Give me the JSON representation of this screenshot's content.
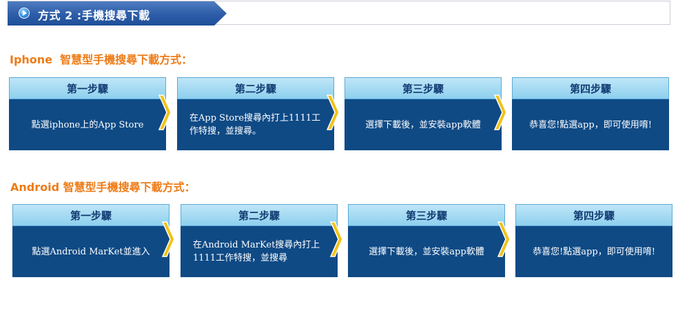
{
  "banner": {
    "title": "方式 2 :手機搜尋下載"
  },
  "iphone_section": {
    "title": "Iphone  智慧型手機搜尋下載方式：",
    "steps": [
      {
        "label": "第一步驟",
        "text": "點選iphone上的App Store"
      },
      {
        "label": "第二步驟",
        "text": "在App Store搜尋內打上1111工作特搜，並搜尋。"
      },
      {
        "label": "第三步驟",
        "text": "選擇下載後，並安裝app軟體"
      },
      {
        "label": "第四步驟",
        "text": "恭喜您!點選app，即可使用唷!"
      }
    ]
  },
  "android_section": {
    "title": "Android 智慧型手機搜尋下載方式：",
    "steps": [
      {
        "label": "第一步驟",
        "text": "點選Android MarKet並進入"
      },
      {
        "label": "第二步驟",
        "text": "在Android MarKet搜尋內打上1111工作特搜，並搜尋"
      },
      {
        "label": "第三步驟",
        "text": "選擇下載後，並安裝app軟體"
      },
      {
        "label": "第四步驟",
        "text": "恭喜您!點選app，即可使用唷!"
      }
    ]
  },
  "colors": {
    "heading_orange": "#ee7b16",
    "step_header": "#8ed0ee",
    "step_body": "#0f4a85",
    "arrow_yellow": "#f2c21a",
    "banner_blue": "#2d5da8"
  },
  "icons": {
    "banner": "play-circle-icon",
    "step_connector": "chevron-right-icon"
  }
}
